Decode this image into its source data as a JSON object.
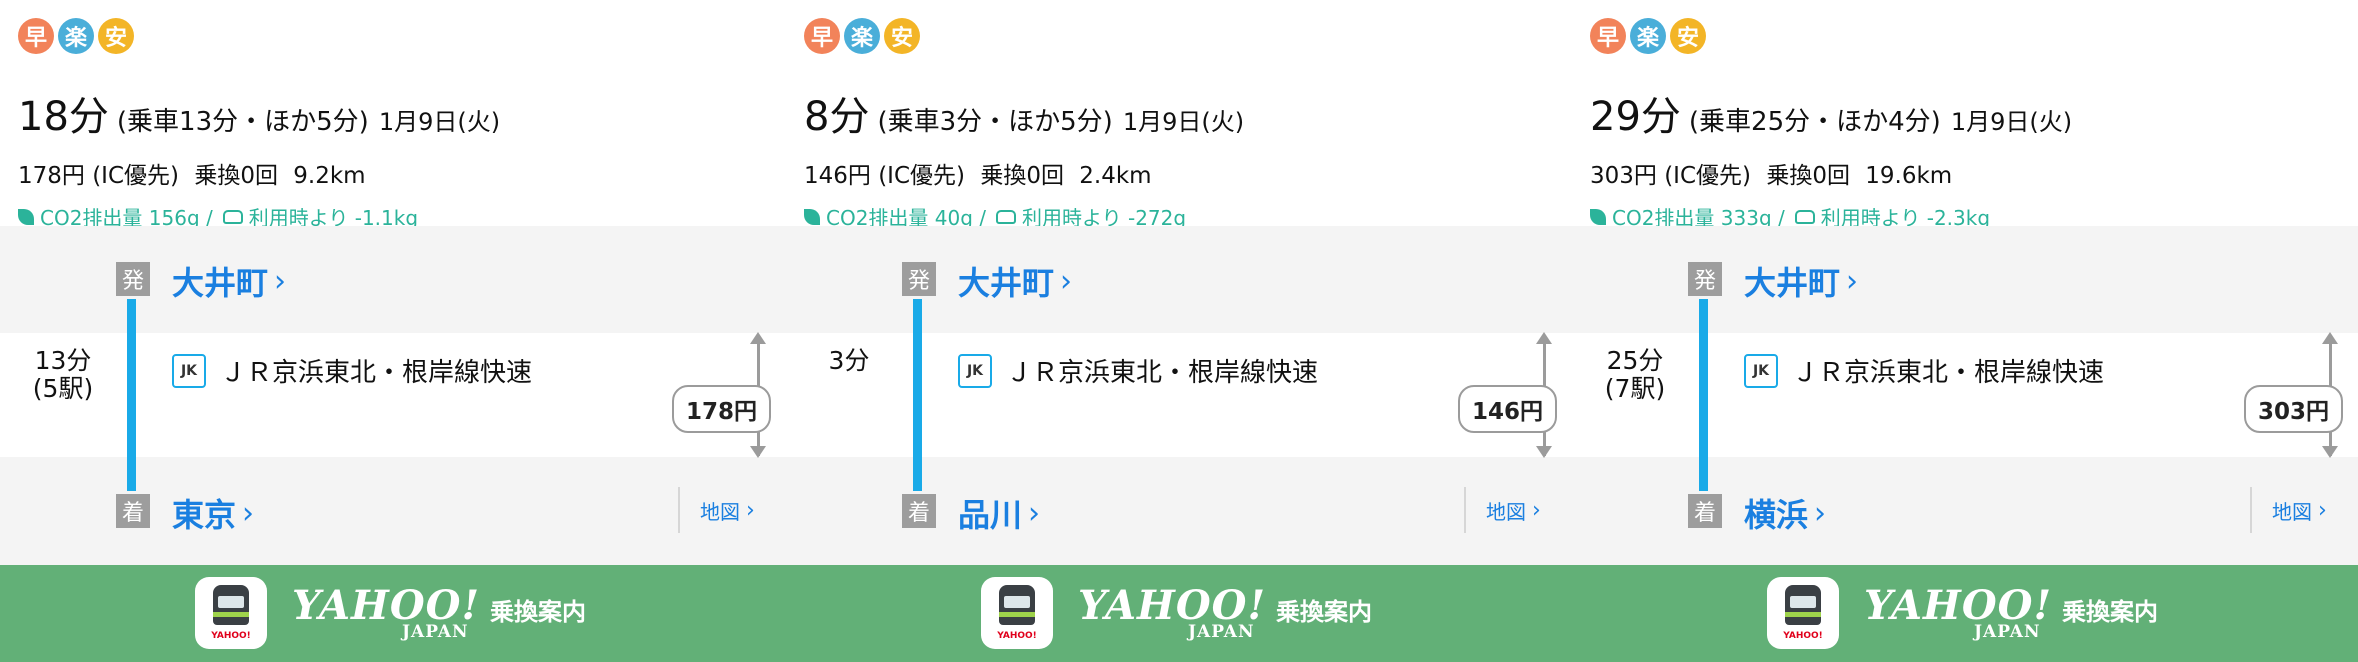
{
  "badge_colors": [
    "#f2835a",
    "#4aaed9",
    "#f3b527"
  ],
  "routes": [
    {
      "badges": [
        "早",
        "楽",
        "安"
      ],
      "total_time": "18分",
      "detail": "(乗車13分・ほか5分)",
      "date": "1月9日(火)",
      "fare": "178円 (IC優先)",
      "transfers": "乗換0回",
      "distance": "9.2km",
      "co2": "CO2排出量 156g /",
      "car_compare": "利用時より -1.1kg",
      "dep_mark": "発",
      "departure": "大井町",
      "arr_mark": "着",
      "arrival": "東京",
      "duration": "13分",
      "stops": "(5駅)",
      "line_icon": "JK",
      "line": "ＪＲ京浜東北・根岸線快速",
      "fare_tag": "178円",
      "map": "地図"
    },
    {
      "badges": [
        "早",
        "楽",
        "安"
      ],
      "total_time": "8分",
      "detail": "(乗車3分・ほか5分)",
      "date": "1月9日(火)",
      "fare": "146円 (IC優先)",
      "transfers": "乗換0回",
      "distance": "2.4km",
      "co2": "CO2排出量 40g /",
      "car_compare": "利用時より -272g",
      "dep_mark": "発",
      "departure": "大井町",
      "arr_mark": "着",
      "arrival": "品川",
      "duration": "3分",
      "stops": "",
      "line_icon": "JK",
      "line": "ＪＲ京浜東北・根岸線快速",
      "fare_tag": "146円",
      "map": "地図"
    },
    {
      "badges": [
        "早",
        "楽",
        "安"
      ],
      "total_time": "29分",
      "detail": "(乗車25分・ほか4分)",
      "date": "1月9日(火)",
      "fare": "303円 (IC優先)",
      "transfers": "乗換0回",
      "distance": "19.6km",
      "co2": "CO2排出量 333g /",
      "car_compare": "利用時より -2.3kg",
      "dep_mark": "発",
      "departure": "大井町",
      "arr_mark": "着",
      "arrival": "横浜",
      "duration": "25分",
      "stops": "(7駅)",
      "line_icon": "JK",
      "line": "ＪＲ京浜東北・根岸線快速",
      "fare_tag": "303円",
      "map": "地図"
    }
  ],
  "footer": {
    "icon_text": "YAHOO!",
    "brand": "YAHOO!",
    "brand_sub": "JAPAN",
    "service": "乗換案内",
    "bg_color": "#62b077"
  },
  "chevron": "›"
}
